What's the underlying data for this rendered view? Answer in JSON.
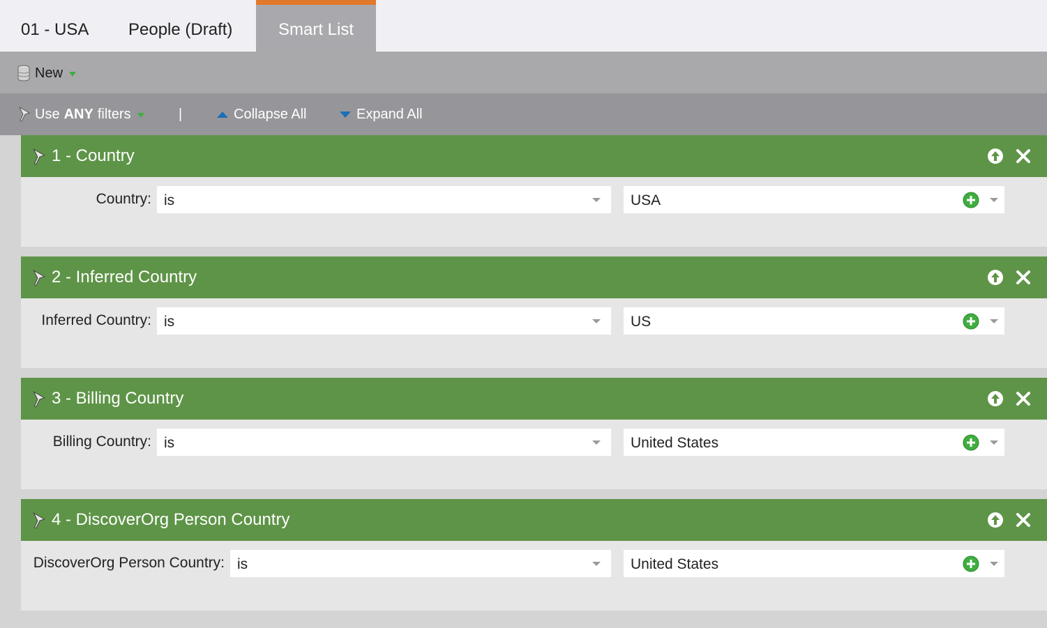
{
  "tabs": [
    {
      "label": "01 - USA"
    },
    {
      "label": "People (Draft)"
    },
    {
      "label": "Smart List"
    }
  ],
  "toolbar": {
    "new_label": "New"
  },
  "filter_bar": {
    "use_prefix": "Use",
    "use_bold": "ANY",
    "use_suffix": "filters",
    "separator": "|",
    "collapse_label": "Collapse All",
    "expand_label": "Expand All"
  },
  "filters": [
    {
      "title": "1 - Country",
      "label": "Country:",
      "operator": "is",
      "value": "USA"
    },
    {
      "title": "2 - Inferred Country",
      "label": "Inferred Country:",
      "operator": "is",
      "value": "US"
    },
    {
      "title": "3 - Billing Country",
      "label": "Billing Country:",
      "operator": "is",
      "value": "United States"
    },
    {
      "title": "4 - DiscoverOrg Person Country",
      "label": "DiscoverOrg Person Country:",
      "operator": "is",
      "value": "United States"
    }
  ],
  "colors": {
    "accent_tab": "#e2782a",
    "filter_header": "#5e9447",
    "link_blue": "#1c6fb5",
    "plus_green": "#3fae3f"
  },
  "icons": [
    "database-icon",
    "dropdown-arrow-icon",
    "pin-icon",
    "triangle-up-icon",
    "triangle-down-icon",
    "arrow-up-circle-icon",
    "close-x-icon",
    "plus-circle-icon"
  ]
}
